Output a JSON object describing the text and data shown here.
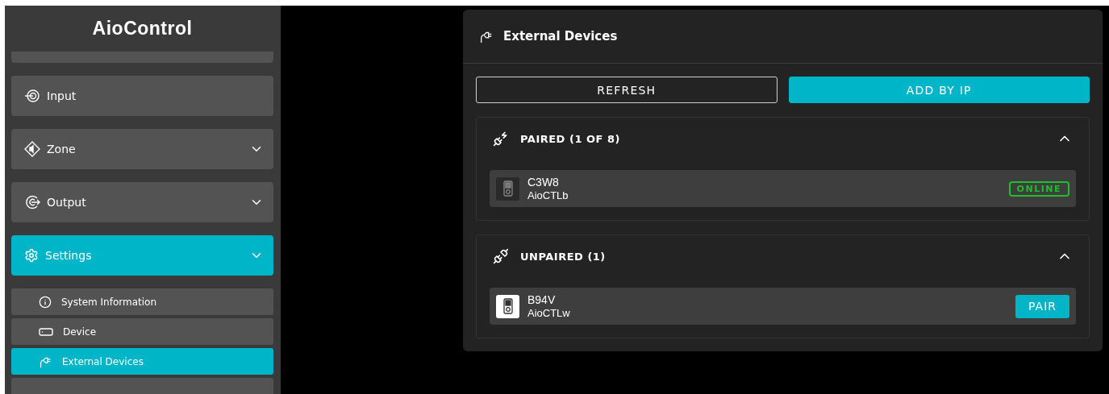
{
  "sidebar": {
    "logo": "AioControl",
    "items": [
      {
        "label": "Input",
        "chevron": false,
        "selected": false
      },
      {
        "label": "Zone",
        "chevron": true,
        "selected": false
      },
      {
        "label": "Output",
        "chevron": true,
        "selected": false
      },
      {
        "label": "Settings",
        "chevron": true,
        "selected": true,
        "children": [
          {
            "label": "System Information",
            "selected": false
          },
          {
            "label": "Device",
            "selected": false
          },
          {
            "label": "External Devices",
            "selected": true
          }
        ]
      }
    ]
  },
  "panel": {
    "title": "External Devices",
    "buttons": [
      {
        "label": "REFRESH",
        "kind": "outline"
      },
      {
        "label": "ADD BY IP",
        "kind": "filled"
      }
    ],
    "sections": [
      {
        "kind": "paired",
        "title": "PAIRED (1 OF 8)",
        "expanded": true,
        "devices": [
          {
            "name": "C3W8",
            "model": "AioCTLb",
            "status": "ONLINE"
          }
        ]
      },
      {
        "kind": "unpaired",
        "title": "UNPAIRED (1)",
        "expanded": true,
        "devices": [
          {
            "name": "B94V",
            "model": "AioCTLw",
            "action": "PAIR"
          }
        ]
      }
    ]
  }
}
